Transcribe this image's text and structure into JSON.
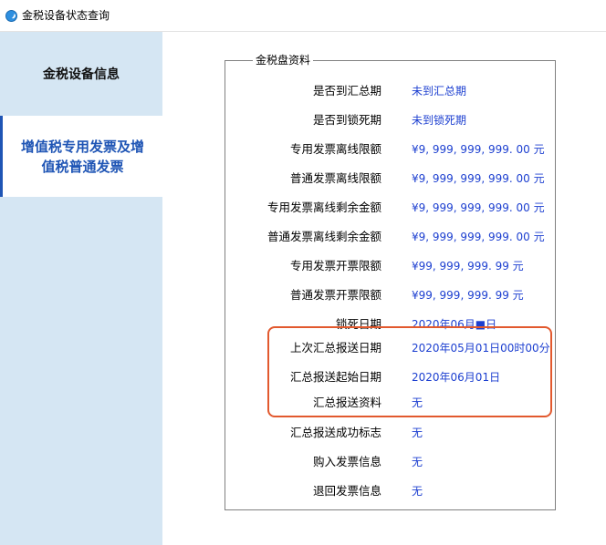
{
  "window": {
    "title": "金税设备状态查询",
    "icon": "app-globe-icon"
  },
  "sidebar": {
    "items": [
      {
        "label": "金税设备信息",
        "active": false
      },
      {
        "label": "增值税专用发票及增\n值税普通发票",
        "active": true
      }
    ]
  },
  "group": {
    "legend": "金税盘资料",
    "rows": [
      {
        "label": "是否到汇总期",
        "value": "未到汇总期"
      },
      {
        "label": "是否到锁死期",
        "value": "未到锁死期"
      },
      {
        "label": "专用发票离线限额",
        "value": "¥9, 999, 999, 999. 00 元"
      },
      {
        "label": "普通发票离线限额",
        "value": "¥9, 999, 999, 999. 00 元"
      },
      {
        "label": "专用发票离线剩余金额",
        "value": "¥9, 999, 999, 999. 00 元"
      },
      {
        "label": "普通发票离线剩余金额",
        "value": "¥9, 999, 999, 999. 00 元"
      },
      {
        "label": "专用发票开票限额",
        "value": "¥99, 999, 999. 99 元"
      },
      {
        "label": "普通发票开票限额",
        "value": "¥99, 999, 999. 99 元"
      },
      {
        "label": "锁死日期",
        "value": "2020年06月■日"
      },
      {
        "label": "上次汇总报送日期",
        "value": "2020年05月01日00时00分"
      },
      {
        "label": "汇总报送起始日期",
        "value": "2020年06月01日"
      },
      {
        "label": "汇总报送资料",
        "value": "无"
      },
      {
        "label": "汇总报送成功标志",
        "value": "无"
      },
      {
        "label": "购入发票信息",
        "value": "无"
      },
      {
        "label": "退回发票信息",
        "value": "无"
      }
    ]
  },
  "colors": {
    "sidebar_bg": "#d5e6f3",
    "active_text": "#1f55b5",
    "value_text": "#1c3fd0",
    "highlight_border": "#e2592e"
  }
}
